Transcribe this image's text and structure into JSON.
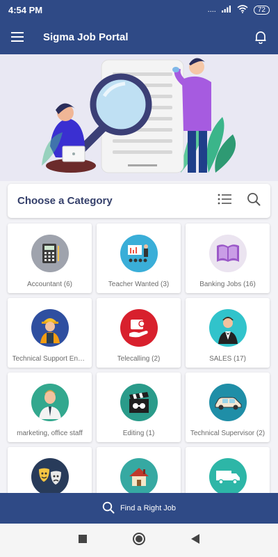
{
  "status_bar": {
    "time": "4:54 PM",
    "network": "....",
    "battery": "72"
  },
  "app_bar": {
    "title": "Sigma Job Portal",
    "menu_icon": "hamburger-icon",
    "notification_icon": "bell-icon"
  },
  "category_header": {
    "title": "Choose a Category",
    "list_icon": "list-icon",
    "search_icon": "search-icon"
  },
  "categories": [
    {
      "label": "Accountant (6)",
      "icon": "calculator-icon",
      "color": "#9fa3ad"
    },
    {
      "label": "Teacher Wanted  (3)",
      "icon": "presentation-icon",
      "color": "#3aaed8"
    },
    {
      "label": "Banking Jobs (16)",
      "icon": "book-icon",
      "color": "#ebe4f0"
    },
    {
      "label": "Technical Support Engineer",
      "icon": "worker-icon",
      "color": "#2f4fa0"
    },
    {
      "label": "Telecalling (2)",
      "icon": "call-center-icon",
      "color": "#d8202d"
    },
    {
      "label": "SALES (17)",
      "icon": "waiter-icon",
      "color": "#31c3cb"
    },
    {
      "label": "marketing, office staff",
      "icon": "man-icon",
      "color": "#33a88e"
    },
    {
      "label": "Editing (1)",
      "icon": "clapperboard-icon",
      "color": "#2a9b8a"
    },
    {
      "label": "Technical Supervisor (2)",
      "icon": "car-icon",
      "color": "#1f8ea7"
    },
    {
      "label": "",
      "icon": "theater-masks-icon",
      "color": "#283b5a"
    },
    {
      "label": "",
      "icon": "house-icon",
      "color": "#36a9a2"
    },
    {
      "label": "",
      "icon": "truck-icon",
      "color": "#2db6a7"
    }
  ],
  "find_bar": {
    "label": "Find a Right Job",
    "icon": "search-icon"
  },
  "nav": {
    "recent": "recent-apps-icon",
    "home": "home-icon",
    "back": "back-icon"
  }
}
